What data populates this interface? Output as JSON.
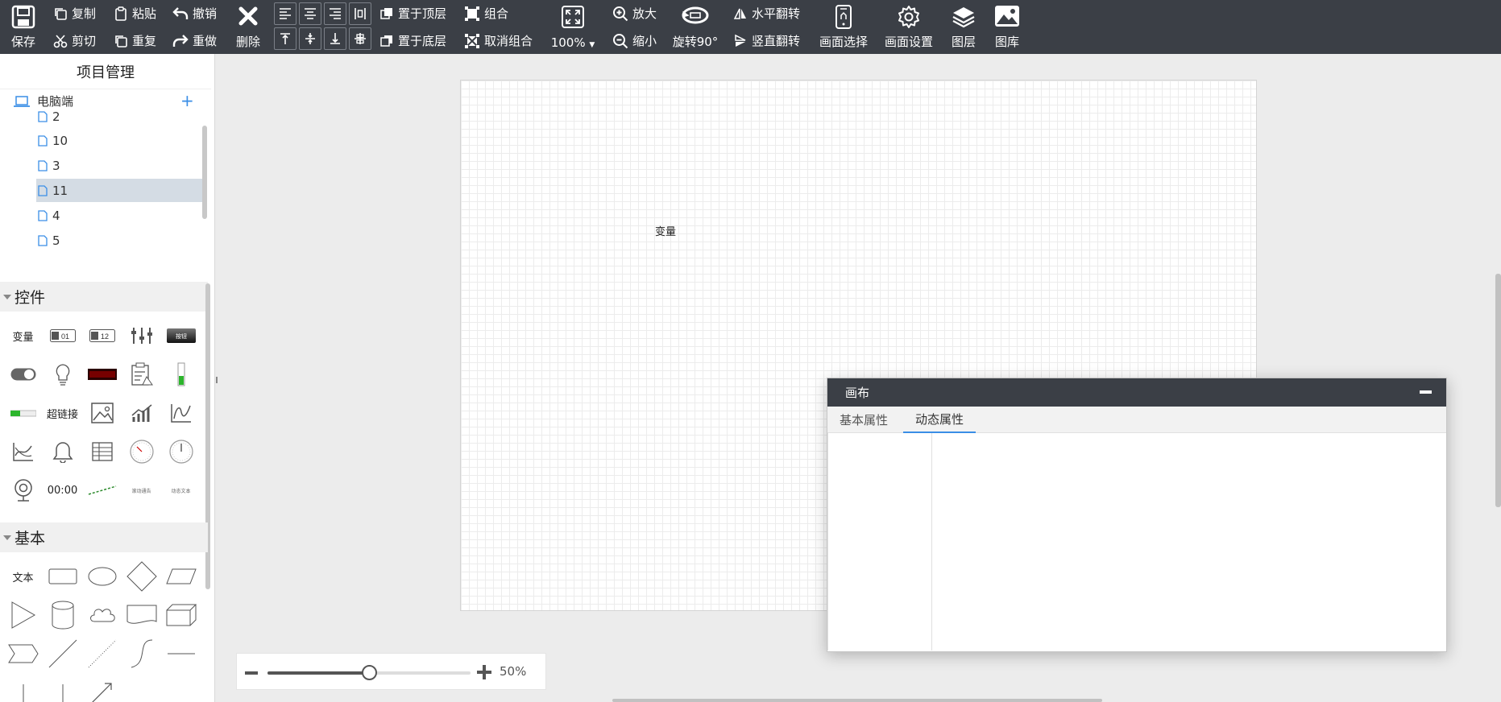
{
  "toolbar": {
    "save": "保存",
    "copy": "复制",
    "cut": "剪切",
    "paste": "粘贴",
    "redo_repeat": "重复",
    "undo": "撤销",
    "redo": "重做",
    "delete": "删除",
    "bring_front": "置于顶层",
    "send_back": "置于底层",
    "group": "组合",
    "ungroup": "取消组合",
    "zoom_level": "100%",
    "zoom_in": "放大",
    "zoom_out": "缩小",
    "rotate": "旋转90°",
    "flip_h": "水平翻转",
    "flip_v": "竖直翻转",
    "screen_select": "画面选择",
    "screen_settings": "画面设置",
    "layers": "图层",
    "gallery": "图库"
  },
  "project": {
    "title": "项目管理",
    "root": "电脑端",
    "pages": [
      "2",
      "10",
      "3",
      "11",
      "4",
      "5"
    ],
    "selected_page": "11"
  },
  "controls": {
    "title": "控件",
    "items": {
      "variable": "变量",
      "num01": "01",
      "num12": "12",
      "button": "按钮",
      "hyperlink": "超链接",
      "clock": "00:00",
      "scroll_text": "滚动通告",
      "dynamic_text": "动态文本"
    }
  },
  "basic": {
    "title": "基本",
    "text": "文本"
  },
  "canvas": {
    "variable_label": "变量"
  },
  "zoom": {
    "value": "50%",
    "level": 0.5
  },
  "dialog": {
    "title": "画布",
    "tab_basic": "基本属性",
    "tab_dynamic": "动态属性",
    "active_tab": "动态属性"
  },
  "colors": {
    "toolbar_bg": "#3b3f46",
    "accent": "#3a8ee6",
    "selected_row": "#d4dce4"
  }
}
